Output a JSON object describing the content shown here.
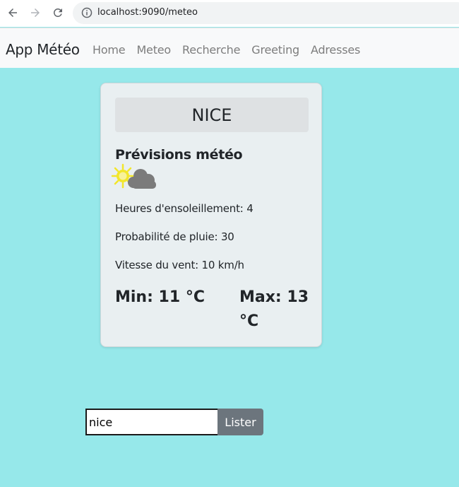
{
  "browser": {
    "url": "localhost:9090/meteo"
  },
  "navbar": {
    "brand": "App Météo",
    "links": [
      "Home",
      "Meteo",
      "Recherche",
      "Greeting",
      "Adresses"
    ]
  },
  "card": {
    "city": "NICE",
    "title": "Prévisions météo",
    "weather_icon": "sun-cloud-icon",
    "sunshine": "Heures d'ensoleillement: 4",
    "rain": "Probabilité de pluie: 30",
    "wind": "Vitesse du vent: 10 km/h",
    "min": "Min: 11 °C",
    "max": "Max: 13 °C"
  },
  "search": {
    "value": "nice",
    "button_label": "Lister"
  },
  "colors": {
    "page_background": "#96e8ea",
    "card_background": "#e9eff1",
    "button_background": "#6c757d"
  }
}
